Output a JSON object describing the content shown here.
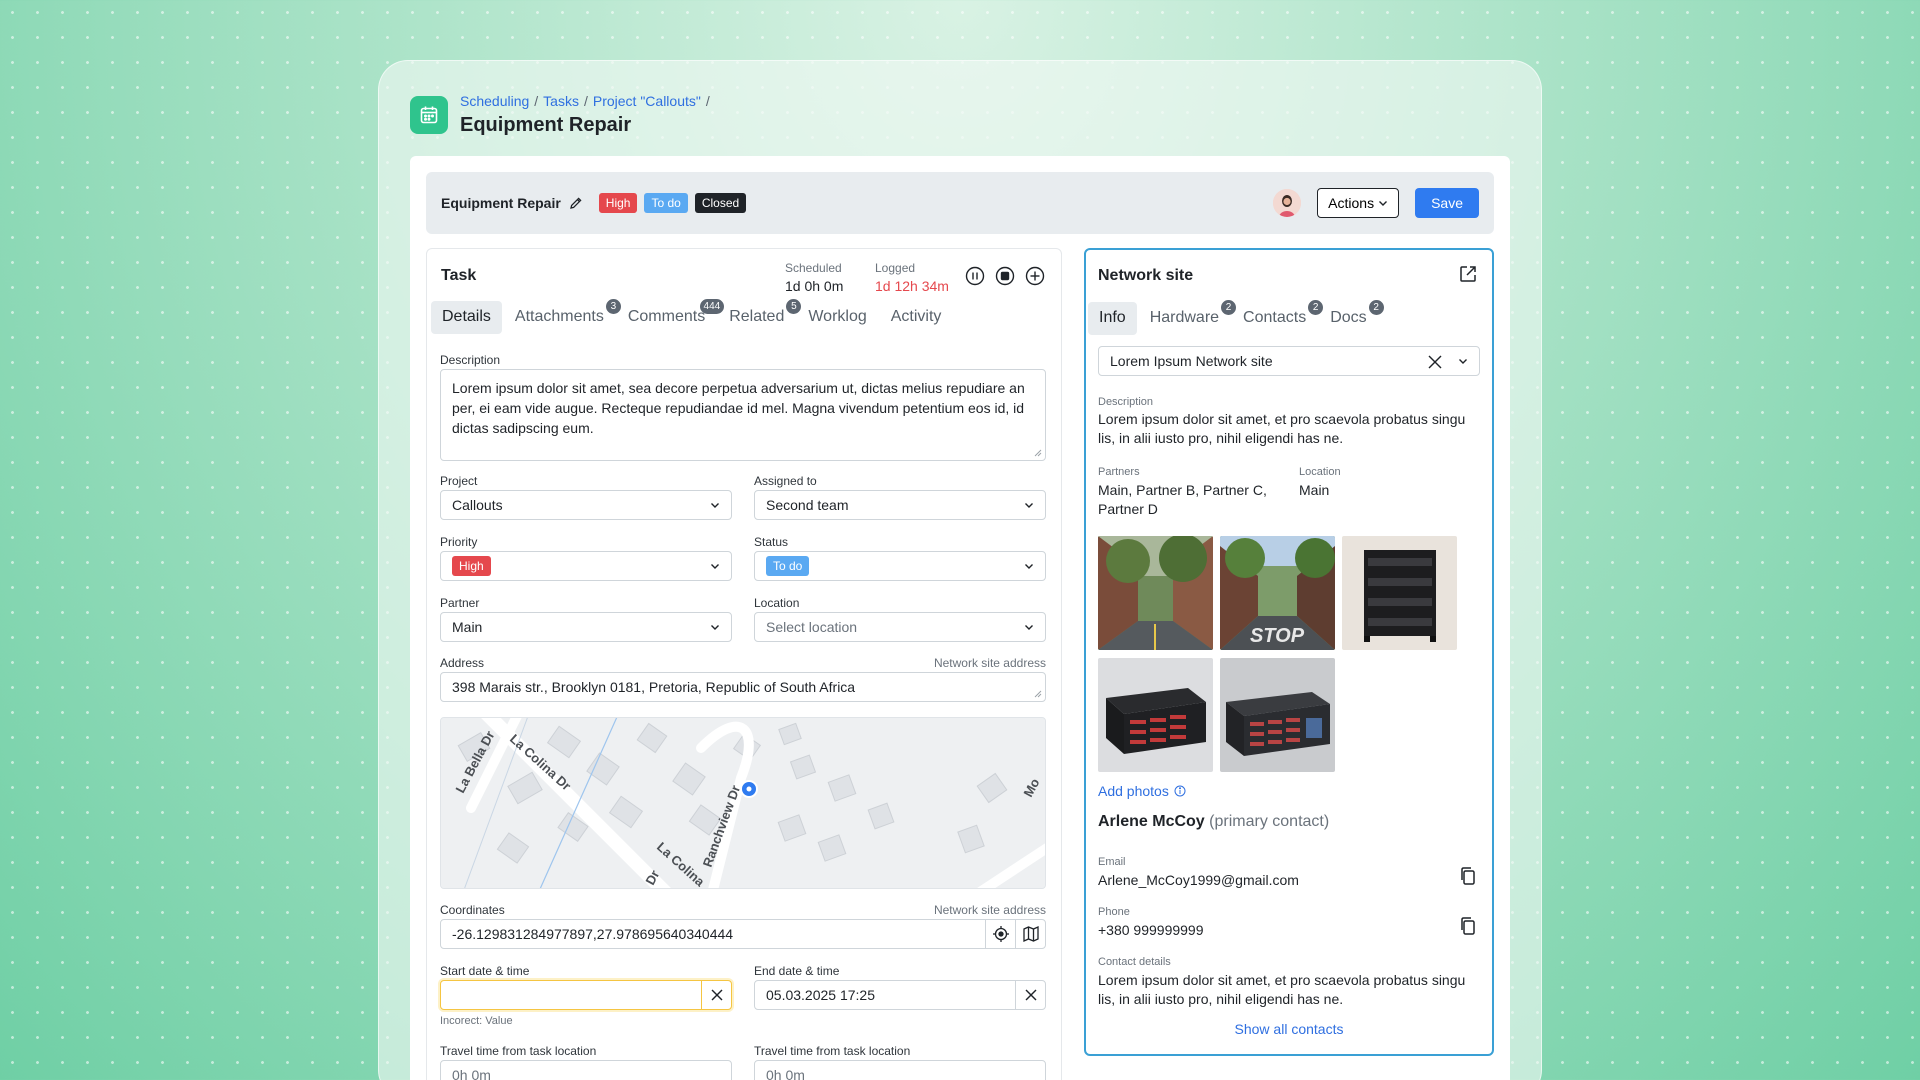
{
  "breadcrumb": {
    "items": [
      "Scheduling",
      "Tasks",
      "Project \"Callouts\""
    ],
    "separator": "/"
  },
  "page_title": "Equipment Repair",
  "header": {
    "task_name": "Equipment Repair",
    "badges": {
      "priority": "High",
      "status": "To do",
      "state": "Closed"
    },
    "actions_label": "Actions",
    "save_label": "Save"
  },
  "task": {
    "title": "Task",
    "scheduled_label": "Scheduled",
    "scheduled_value": "1d 0h 0m",
    "logged_label": "Logged",
    "logged_value": "1d 12h 34m",
    "tabs": [
      {
        "label": "Details"
      },
      {
        "label": "Attachments",
        "count": "3"
      },
      {
        "label": "Comments",
        "count": "444"
      },
      {
        "label": "Related",
        "count": "5"
      },
      {
        "label": "Worklog"
      },
      {
        "label": "Activity"
      }
    ],
    "description_label": "Description",
    "description_value": "Lorem ipsum dolor sit amet, sea decore perpetua adversarium ut, dictas melius repudiare an per, ei eam vide augue. Recteque repudiandae id mel. Magna vivendum petentium eos id, id dictas sadipscing eum.",
    "project_label": "Project",
    "project_value": "Callouts",
    "assigned_label": "Assigned to",
    "assigned_value": "Second team",
    "priority_label": "Priority",
    "priority_value": "High",
    "status_label": "Status",
    "status_value": "To do",
    "partner_label": "Partner",
    "partner_value": "Main",
    "location_label": "Location",
    "location_placeholder": "Select location",
    "address_label": "Address",
    "address_hint": "Network site address",
    "address_value": "398 Marais str., Brooklyn 0181, Pretoria, Republic of South Africa",
    "map_labels": [
      "La Colina Dr",
      "La Bella Dr",
      "Ranchview Dr",
      "La Colina",
      "Dr",
      "Mo"
    ],
    "coordinates_label": "Coordinates",
    "coordinates_hint": "Network site address",
    "coordinates_value": "-26.129831284977897,27.978695640340444",
    "start_label": "Start date & time",
    "start_value": "",
    "start_error": "Incorect: Value",
    "end_label": "End date & time",
    "end_value": "05.03.2025 17:25",
    "travel_label_1": "Travel time from task location",
    "travel_value_1": "0h 0m",
    "travel_label_2": "Travel time from task location",
    "travel_value_2": "0h 0m"
  },
  "site": {
    "title": "Network site",
    "tabs": [
      {
        "label": "Info"
      },
      {
        "label": "Hardware",
        "count": "2"
      },
      {
        "label": "Contacts",
        "count": "2"
      },
      {
        "label": "Docs",
        "count": "2"
      }
    ],
    "selected": "Lorem Ipsum Network site",
    "description_label": "Description",
    "description_value": "Lorem ipsum dolor sit amet, et pro scaevola probatus singu lis, in alii iusto pro, nihil eligendi has ne.",
    "partners_label": "Partners",
    "partners_value": "Main, Partner B, Partner C, Partner D",
    "location_label": "Location",
    "location_value": "Main",
    "photo_road_sign_text": "STOP",
    "add_photos": "Add photos",
    "contact_name": "Arlene McCoy",
    "contact_role": "(primary contact)",
    "email_label": "Email",
    "email_value": "Arlene_McCoy1999@gmail.com",
    "phone_label": "Phone",
    "phone_value": "+380 999999999",
    "details_label": "Contact details",
    "details_value": "Lorem ipsum dolor sit amet, et pro scaevola probatus singu lis, in alii iusto pro, nihil eligendi has ne.",
    "show_all": "Show all contacts"
  },
  "colors": {
    "accent": "#2f7bf0",
    "brand": "#2fc48d",
    "danger": "#e5484d",
    "status_todo": "#5aa9f2",
    "warning_border": "#f5c542"
  }
}
